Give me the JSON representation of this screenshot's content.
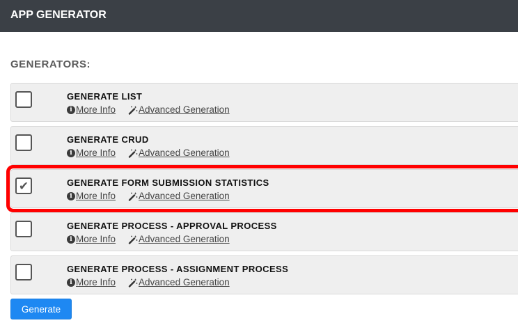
{
  "header": {
    "title": "APP GENERATOR"
  },
  "section": {
    "title": "GENERATORS:"
  },
  "links": {
    "more_info": "More Info",
    "advanced": "Advanced Generation"
  },
  "generators": [
    {
      "title": "GENERATE LIST",
      "checked": false
    },
    {
      "title": "GENERATE CRUD",
      "checked": false
    },
    {
      "title": "GENERATE FORM SUBMISSION STATISTICS",
      "checked": true
    },
    {
      "title": "GENERATE PROCESS - APPROVAL PROCESS",
      "checked": false
    },
    {
      "title": "GENERATE PROCESS - ASSIGNMENT PROCESS",
      "checked": false
    }
  ],
  "actions": {
    "generate_label": "Generate"
  },
  "icons": {
    "info": "info-circle-icon",
    "advanced": "magic-wand-icon",
    "check": "checkmark-icon"
  },
  "colors": {
    "header_bg": "#3b4046",
    "button_bg": "#1e88f2",
    "highlight": "#ff0000"
  }
}
